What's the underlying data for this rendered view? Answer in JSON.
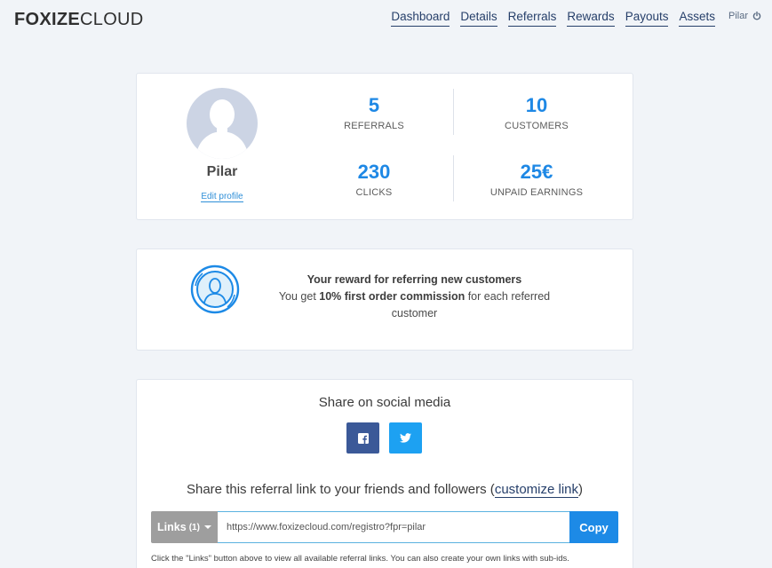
{
  "header": {
    "logo_bold": "FOXIZE",
    "logo_light": "CLOUD",
    "nav": [
      "Dashboard",
      "Details",
      "Referrals",
      "Rewards",
      "Payouts",
      "Assets"
    ],
    "user": "Pilar"
  },
  "profile": {
    "name": "Pilar",
    "edit_label": "Edit profile"
  },
  "stats": {
    "referrals": {
      "value": "5",
      "label": "REFERRALS"
    },
    "customers": {
      "value": "10",
      "label": "CUSTOMERS"
    },
    "clicks": {
      "value": "230",
      "label": "CLICKS"
    },
    "unpaid": {
      "value": "25€",
      "label": "UNPAID EARNINGS"
    }
  },
  "reward": {
    "title": "Your reward for referring new customers",
    "pre": "You get ",
    "highlight": "10% first order commission",
    "post": " for each referred customer"
  },
  "share": {
    "title": "Share on social media",
    "link_text": "Share this referral link to your friends and followers (",
    "customize_label": "customize link",
    "link_close": ")",
    "links_label": "Links",
    "links_count": "(1)",
    "url": "https://www.foxizecloud.com/registro?fpr=pilar",
    "copy_label": "Copy",
    "help": "Click the \"Links\" button above to view all available referral links. You can also create your own links with sub-ids."
  },
  "colors": {
    "accent": "#1e88e5",
    "facebook": "#3b5998",
    "twitter": "#1da1f2",
    "nav": "#263f6a"
  }
}
